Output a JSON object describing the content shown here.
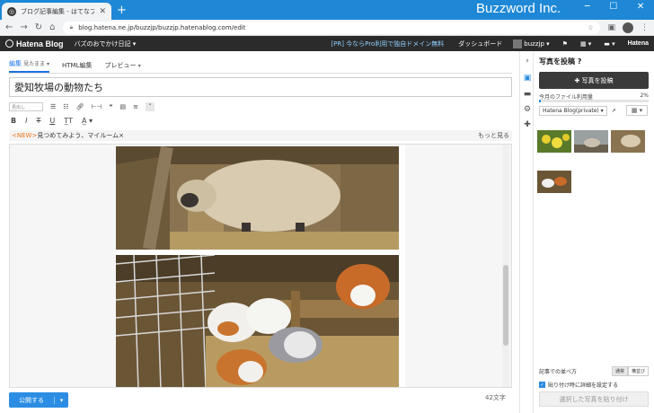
{
  "browser": {
    "tab_title": "ブログ記事編集 - はてなブログ",
    "new_tab": "+",
    "brand": "Buzzword Inc.",
    "url": "blog.hatena.ne.jp/buzzjp/buzzjp.hatenablog.com/edit"
  },
  "hatena_bar": {
    "logo": "Hatena Blog",
    "blog_name": "バズのおでかけ日記 ▾",
    "promo": "[PR] 今ならPro利用で独自ドメイン無料",
    "dashboard": "ダッシュボード",
    "user": "buzzjp ▾",
    "hatena": "Hatena"
  },
  "editor": {
    "tabs": [
      {
        "label": "編集",
        "sub": "見たまま ▾"
      },
      {
        "label": "HTML編集",
        "sub": ""
      },
      {
        "label": "プレビュー",
        "sub": "▾"
      }
    ],
    "title": "愛知牧場の動物たち",
    "heading_select": "見出し",
    "notice_new": "<NEW>",
    "notice_text": "見つめてみよう、マイルーム×",
    "notice_more": "もっと見る",
    "publish": "公開する",
    "publish_arrow": "▾",
    "char_count": "42文字"
  },
  "panel": {
    "title": "写真を投稿",
    "help": "?",
    "post_button": "✚ 写真を投稿",
    "usage_label": "今月のファイル利用量",
    "usage_pct": "2%",
    "usage_fraction": 0.02,
    "album": "Hatena Blog(private) ▾",
    "grid": "▦ ▾",
    "sort_label": "記事での並べ方",
    "sort_options": [
      "通常",
      "横並び"
    ],
    "detail_label": "貼り付け時に詳細を設定する",
    "paste_button": "選択した写真を貼り付け"
  },
  "colors": {
    "titlebar": "#1e88d6",
    "accent": "#2b8de3",
    "hatena_bar": "#2b2b2b"
  }
}
